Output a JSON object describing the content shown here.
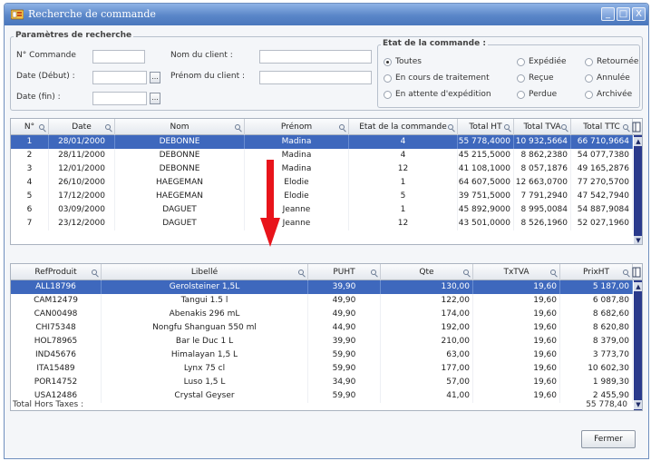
{
  "window": {
    "title": "Recherche de commande",
    "btn_min": "_",
    "btn_max": "□",
    "btn_close": "X"
  },
  "params": {
    "legend": "Paramètres de recherche",
    "num_label": "N° Commande",
    "date_debut_label": "Date (Début) :",
    "date_fin_label": "Date (fin) :",
    "nom_label": "Nom du client :",
    "prenom_label": "Prénom du client :",
    "num_value": "",
    "date_debut_value": "",
    "date_fin_value": "",
    "nom_value": "",
    "prenom_value": "",
    "date_button": "..."
  },
  "etat": {
    "legend": "Etat de la commande :",
    "options": [
      {
        "label": "Toutes",
        "selected": true
      },
      {
        "label": "En cours de traitement",
        "selected": false
      },
      {
        "label": "En attente d'expédition",
        "selected": false
      },
      {
        "label": "Expédiée",
        "selected": false
      },
      {
        "label": "Reçue",
        "selected": false
      },
      {
        "label": "Perdue",
        "selected": false
      },
      {
        "label": "Retournée",
        "selected": false
      },
      {
        "label": "Annulée",
        "selected": false
      },
      {
        "label": "Archivée",
        "selected": false
      }
    ]
  },
  "orders": {
    "columns": [
      "N°",
      "Date",
      "Nom",
      "Prénom",
      "Etat de la commande",
      "Total HT",
      "Total TVA",
      "Total TTC"
    ],
    "rows": [
      [
        "1",
        "28/01/2000",
        "DEBONNE",
        "Madina",
        "4",
        "55 778,4000",
        "10 932,5664",
        "66 710,9664"
      ],
      [
        "2",
        "28/11/2000",
        "DEBONNE",
        "Madina",
        "4",
        "45 215,5000",
        "8 862,2380",
        "54 077,7380"
      ],
      [
        "3",
        "12/01/2000",
        "DEBONNE",
        "Madina",
        "12",
        "41 108,1000",
        "8 057,1876",
        "49 165,2876"
      ],
      [
        "4",
        "26/10/2000",
        "HAEGEMAN",
        "Elodie",
        "1",
        "64 607,5000",
        "12 663,0700",
        "77 270,5700"
      ],
      [
        "5",
        "17/12/2000",
        "HAEGEMAN",
        "Elodie",
        "5",
        "39 751,5000",
        "7 791,2940",
        "47 542,7940"
      ],
      [
        "6",
        "03/09/2000",
        "DAGUET",
        "Jeanne",
        "1",
        "45 892,9000",
        "8 995,0084",
        "54 887,9084"
      ],
      [
        "7",
        "23/12/2000",
        "DAGUET",
        "Jeanne",
        "12",
        "43 501,0000",
        "8 526,1960",
        "52 027,1960"
      ]
    ],
    "selected_index": 0
  },
  "lines": {
    "columns": [
      "RefProduit",
      "Libellé",
      "PUHT",
      "Qte",
      "TxTVA",
      "PrixHT"
    ],
    "rows": [
      [
        "ALL18796",
        "Gerolsteiner 1,5L",
        "39,90",
        "130,00",
        "19,60",
        "5 187,00"
      ],
      [
        "CAM12479",
        "Tangui 1.5 l",
        "49,90",
        "122,00",
        "19,60",
        "6 087,80"
      ],
      [
        "CAN00498",
        "Abenakis 296 mL",
        "49,90",
        "174,00",
        "19,60",
        "8 682,60"
      ],
      [
        "CHI75348",
        "Nongfu Shanguan 550 ml",
        "44,90",
        "192,00",
        "19,60",
        "8 620,80"
      ],
      [
        "HOL78965",
        "Bar le Duc 1 L",
        "39,90",
        "210,00",
        "19,60",
        "8 379,00"
      ],
      [
        "IND45676",
        "Himalayan 1,5 L",
        "59,90",
        "63,00",
        "19,60",
        "3 773,70"
      ],
      [
        "ITA15489",
        "Lynx 75 cl",
        "59,90",
        "177,00",
        "19,60",
        "10 602,30"
      ],
      [
        "POR14752",
        "Luso 1,5 L",
        "34,90",
        "57,00",
        "19,60",
        "1 989,30"
      ],
      [
        "USA12486",
        "Crystal Geyser",
        "59,90",
        "41,00",
        "19,60",
        "2 455,90"
      ]
    ],
    "selected_index": 0,
    "total_label": "Total Hors Taxes :",
    "total_value": "55 778,40"
  },
  "footer": {
    "close_label": "Fermer"
  },
  "colors": {
    "selection": "#3e68bd",
    "title_bar": "#5a86c8",
    "annotation_arrow": "#e8141b"
  },
  "icons": {
    "window": "window-app-icon",
    "sort": "magnifier-sort-icon",
    "column_chooser": "column-chooser-icon",
    "arrow": "red-down-arrow-icon"
  }
}
